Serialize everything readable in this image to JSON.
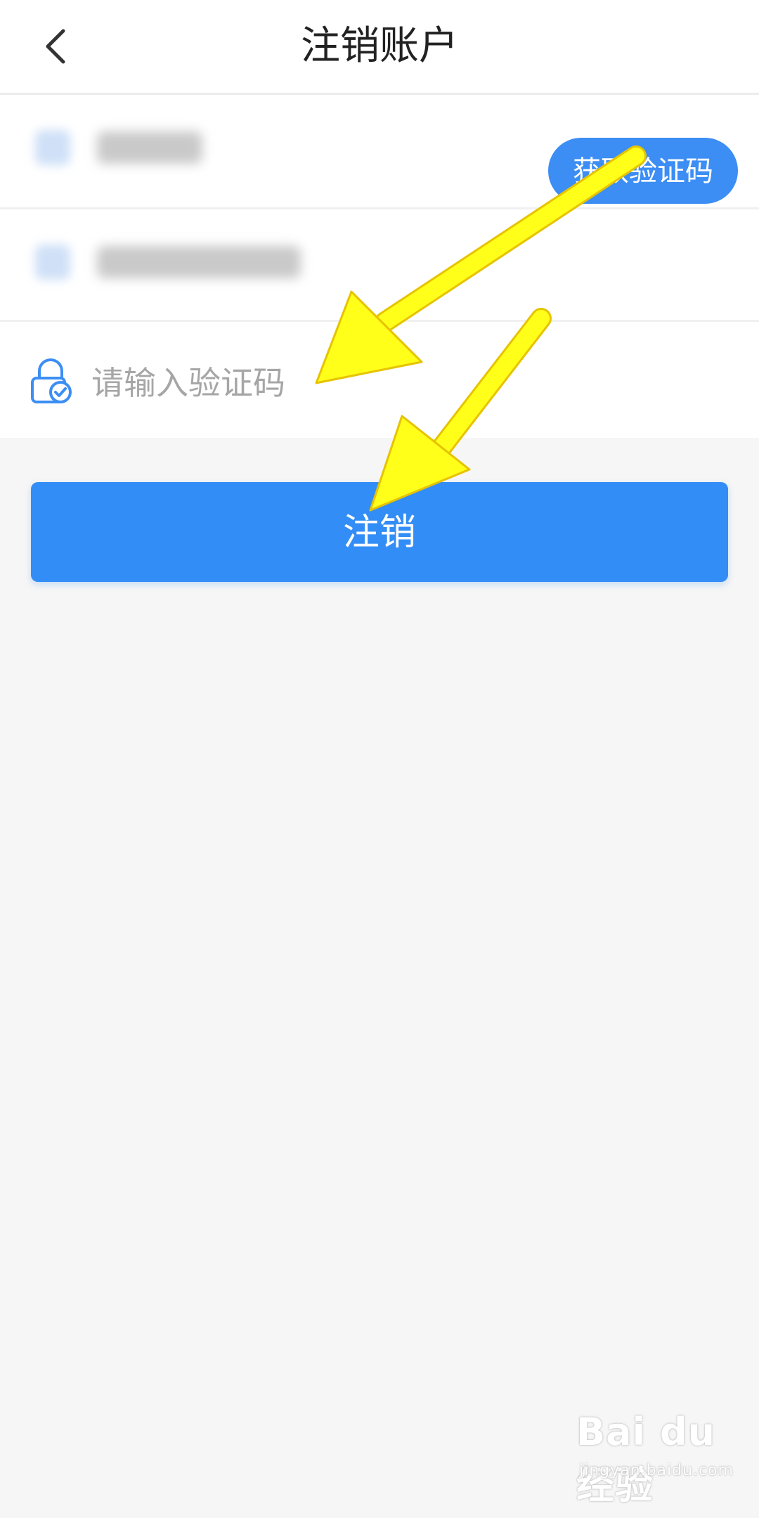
{
  "header": {
    "title": "注销账户",
    "back_icon": "chevron-left-icon"
  },
  "form": {
    "code_placeholder": "请输入验证码",
    "get_code_label": "获取验证码",
    "lock_icon": "lock-check-icon"
  },
  "submit_label": "注销",
  "annotation": {
    "arrow_color": "#ffff1a"
  },
  "watermark": {
    "logo": "Bai du 经验",
    "url": "jingyan.baidu.com"
  },
  "colors": {
    "accent": "#338df6",
    "background": "#f6f6f6"
  }
}
